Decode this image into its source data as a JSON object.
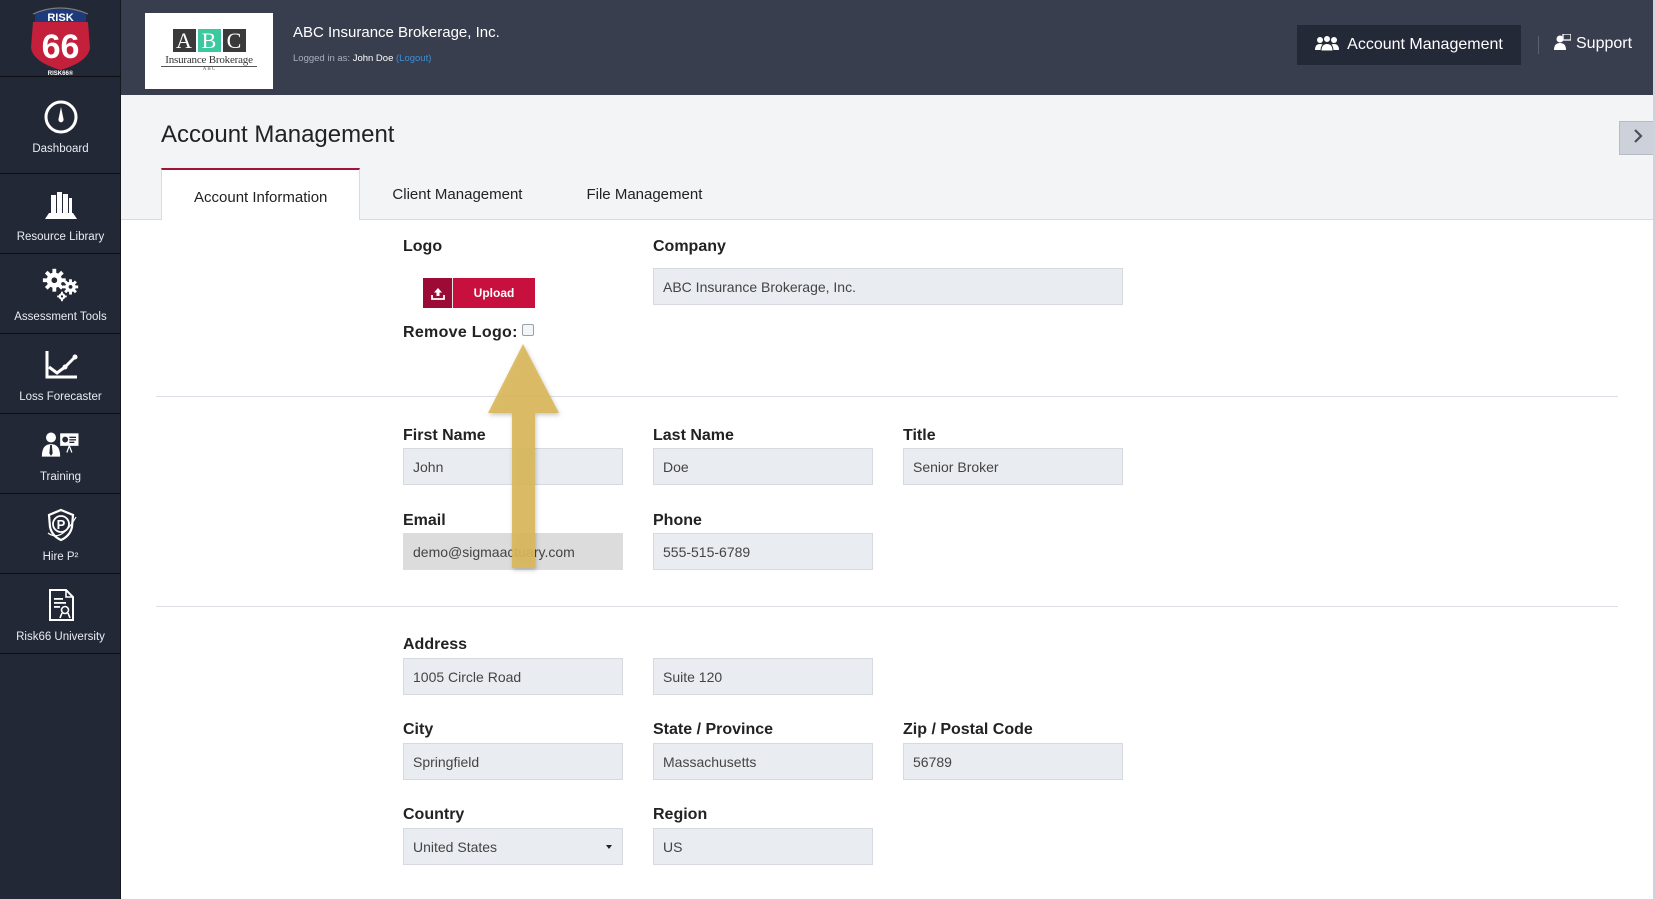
{
  "sidebar": {
    "logo": {
      "top_text": "RISK",
      "number": "66",
      "sub_text": "RISK66®"
    },
    "items": [
      {
        "label": "Dashboard",
        "icon": "dashboard-gauge-icon"
      },
      {
        "label": "Resource Library",
        "icon": "books-icon"
      },
      {
        "label": "Assessment Tools",
        "icon": "gears-icon"
      },
      {
        "label": "Loss Forecaster",
        "icon": "line-chart-icon"
      },
      {
        "label": "Training",
        "icon": "presenter-icon"
      },
      {
        "label": "Hire P²",
        "icon": "shield-p-icon"
      },
      {
        "label": "Risk66 University",
        "icon": "certificate-icon"
      }
    ]
  },
  "header": {
    "brand_logo": {
      "letters": [
        "A",
        "B",
        "C"
      ],
      "line1": "Insurance Brokerage",
      "line2": "A B C"
    },
    "company_name": "ABC Insurance Brokerage, Inc.",
    "logged_in_prefix": "Logged in as:",
    "user_name": "John Doe",
    "logout_label": "(Logout)",
    "account_management_label": "Account Management",
    "support_label": "Support"
  },
  "page": {
    "title": "Account Management",
    "tabs": [
      {
        "label": "Account Information",
        "active": true
      },
      {
        "label": "Client Management",
        "active": false
      },
      {
        "label": "File Management",
        "active": false
      }
    ]
  },
  "form": {
    "logo_label": "Logo",
    "upload_label": "Upload",
    "remove_logo_label": "Remove Logo:",
    "remove_logo_checked": false,
    "company": {
      "label": "Company",
      "value": "ABC Insurance Brokerage, Inc."
    },
    "first_name": {
      "label": "First Name",
      "value": "John"
    },
    "last_name": {
      "label": "Last Name",
      "value": "Doe"
    },
    "title": {
      "label": "Title",
      "value": "Senior Broker"
    },
    "email": {
      "label": "Email",
      "value": "demo@sigmaactuary.com"
    },
    "phone": {
      "label": "Phone",
      "value": "555-515-6789"
    },
    "address": {
      "label": "Address",
      "line1": "1005 Circle Road",
      "line2": "Suite 120"
    },
    "city": {
      "label": "City",
      "value": "Springfield"
    },
    "state": {
      "label": "State / Province",
      "value": "Massachusetts"
    },
    "zip": {
      "label": "Zip / Postal Code",
      "value": "56789"
    },
    "country": {
      "label": "Country",
      "value": "United States"
    },
    "region": {
      "label": "Region",
      "value": "US"
    }
  },
  "annotation": {
    "type": "arrow",
    "direction": "up",
    "target": "remove-logo-checkbox",
    "color": "#d9b75a"
  },
  "colors": {
    "sidebar_bg": "#232836",
    "header_bg": "#393e4f",
    "accent_red": "#c8103e",
    "tab_active_border": "#a3123a",
    "link_blue": "#3b8fd4"
  }
}
